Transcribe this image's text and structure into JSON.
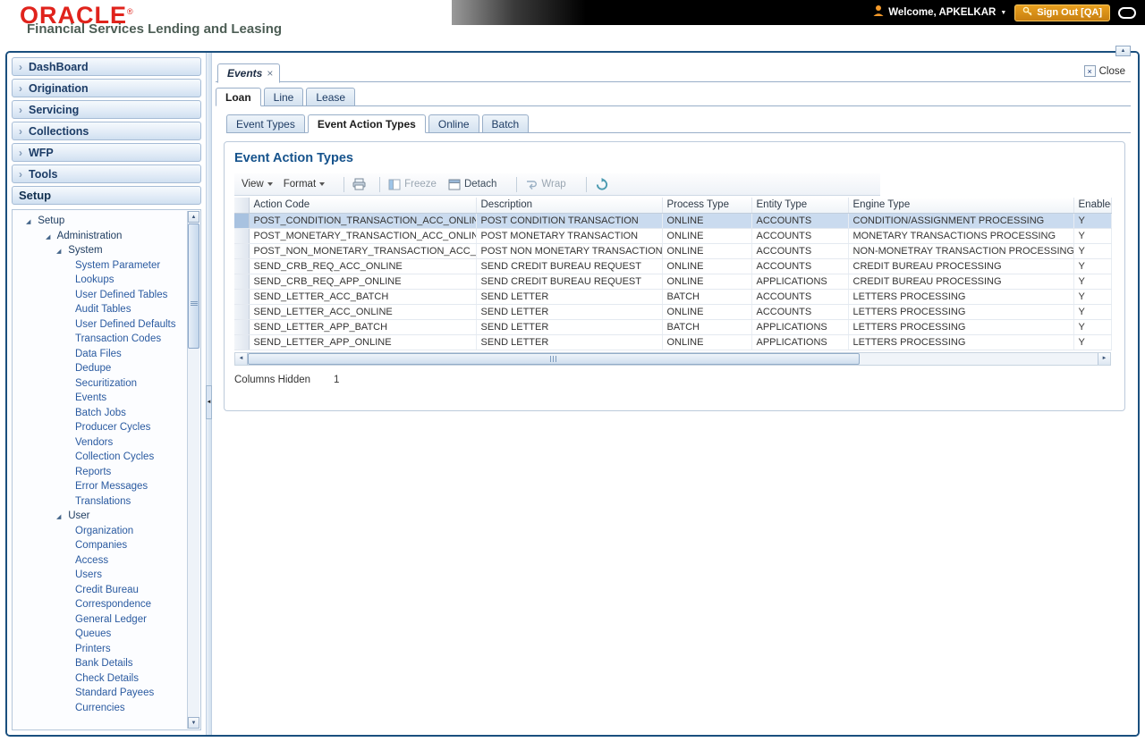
{
  "colors": {
    "brand_red": "#e0231c",
    "frame_blue": "#1a4f7e",
    "accent_blue": "#16538c",
    "link_blue": "#2a5aa0",
    "selected_row": "#cadbef",
    "signout_gold": "#e8a01f"
  },
  "icons": {
    "chevron_right": "›",
    "twisty_expanded": "◢",
    "caret_up": "▲",
    "caret_down": "▼",
    "arrow_left": "◄",
    "arrow_right": "►",
    "close_x": "×"
  },
  "header": {
    "logo": "ORACLE",
    "registered_mark": "®",
    "subtitle": "Financial Services Lending and Leasing",
    "welcome_text": "Welcome, APKELKAR",
    "sign_out_label": "Sign Out [QA]"
  },
  "sidebar": {
    "accordion": [
      {
        "label": "DashBoard"
      },
      {
        "label": "Origination"
      },
      {
        "label": "Servicing"
      },
      {
        "label": "Collections"
      },
      {
        "label": "WFP"
      },
      {
        "label": "Tools"
      },
      {
        "label": "Setup"
      }
    ],
    "tree": {
      "root_label": "Setup",
      "administration_label": "Administration",
      "system_label": "System",
      "system_items": [
        "System Parameter",
        "Lookups",
        "User Defined Tables",
        "Audit Tables",
        "User Defined Defaults",
        "Transaction Codes",
        "Data Files",
        "Dedupe",
        "Securitization",
        "Events",
        "Batch Jobs",
        "Producer Cycles",
        "Vendors",
        "Collection Cycles",
        "Reports",
        "Error Messages",
        "Translations"
      ],
      "user_label": "User",
      "user_items": [
        "Organization",
        "Companies",
        "Access",
        "Users",
        "Credit Bureau",
        "Correspondence",
        "General Ledger",
        "Queues",
        "Printers",
        "Bank Details",
        "Check Details",
        "Standard Payees",
        "Currencies"
      ]
    }
  },
  "content": {
    "document_tab": "Events",
    "close_label": "Close",
    "level2_tabs": [
      "Loan",
      "Line",
      "Lease"
    ],
    "level3_tabs": [
      "Event Types",
      "Event Action Types",
      "Online",
      "Batch"
    ],
    "section_title": "Event Action Types",
    "toolbar": {
      "view_label": "View",
      "format_label": "Format",
      "freeze_label": "Freeze",
      "detach_label": "Detach",
      "wrap_label": "Wrap"
    },
    "table": {
      "columns": [
        "Action Code",
        "Description",
        "Process Type",
        "Entity Type",
        "Engine Type",
        "Enabled"
      ],
      "rows": [
        [
          "POST_CONDITION_TRANSACTION_ACC_ONLINE",
          "POST CONDITION TRANSACTION",
          "ONLINE",
          "ACCOUNTS",
          "CONDITION/ASSIGNMENT PROCESSING",
          "Y"
        ],
        [
          "POST_MONETARY_TRANSACTION_ACC_ONLINE",
          "POST MONETARY TRANSACTION",
          "ONLINE",
          "ACCOUNTS",
          "MONETARY TRANSACTIONS PROCESSING",
          "Y"
        ],
        [
          "POST_NON_MONETARY_TRANSACTION_ACC_ON...",
          "POST NON MONETARY TRANSACTION",
          "ONLINE",
          "ACCOUNTS",
          "NON-MONETRAY TRANSACTION PROCESSING",
          "Y"
        ],
        [
          "SEND_CRB_REQ_ACC_ONLINE",
          "SEND CREDIT BUREAU REQUEST",
          "ONLINE",
          "ACCOUNTS",
          "CREDIT BUREAU PROCESSING",
          "Y"
        ],
        [
          "SEND_CRB_REQ_APP_ONLINE",
          "SEND CREDIT BUREAU REQUEST",
          "ONLINE",
          "APPLICATIONS",
          "CREDIT BUREAU PROCESSING",
          "Y"
        ],
        [
          "SEND_LETTER_ACC_BATCH",
          "SEND LETTER",
          "BATCH",
          "ACCOUNTS",
          "LETTERS PROCESSING",
          "Y"
        ],
        [
          "SEND_LETTER_ACC_ONLINE",
          "SEND LETTER",
          "ONLINE",
          "ACCOUNTS",
          "LETTERS PROCESSING",
          "Y"
        ],
        [
          "SEND_LETTER_APP_BATCH",
          "SEND LETTER",
          "BATCH",
          "APPLICATIONS",
          "LETTERS PROCESSING",
          "Y"
        ],
        [
          "SEND_LETTER_APP_ONLINE",
          "SEND LETTER",
          "ONLINE",
          "APPLICATIONS",
          "LETTERS PROCESSING",
          "Y"
        ]
      ]
    },
    "footer": {
      "columns_hidden_label": "Columns Hidden",
      "columns_hidden_value": "1"
    }
  }
}
